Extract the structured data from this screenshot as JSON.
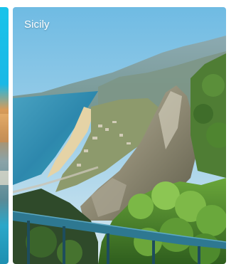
{
  "carousel": {
    "cards": [
      {
        "title": ""
      },
      {
        "title": "Sicily"
      }
    ]
  },
  "colors": {
    "card_title": "#ffffff",
    "sky_top": "#7cc4e6",
    "sea": "#2f8fb3",
    "foliage": "#4f8a2b",
    "railing": "#2a6e86"
  },
  "icons": []
}
